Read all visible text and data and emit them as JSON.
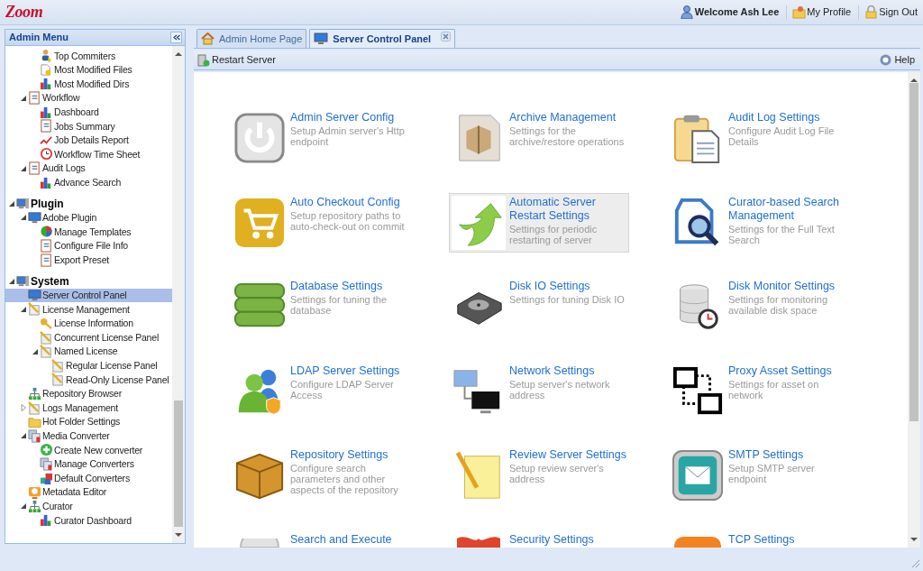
{
  "header": {
    "logo": "Zoom",
    "welcome": "Welcome Ash Lee",
    "links": [
      "My Profile",
      "Sign Out"
    ]
  },
  "sidebar": {
    "title": "Admin Menu",
    "tree": [
      {
        "children": [
          {
            "children": [
              {
                "label": "Top Commiters",
                "selected": false
              },
              {
                "label": "Most Modified Files",
                "selected": false
              },
              {
                "label": "Most Modified Dirs",
                "selected": false
              }
            ]
          },
          {
            "label": "Workflow",
            "selected": false,
            "expanded": true,
            "children": [
              {
                "label": "Dashboard",
                "selected": false
              },
              {
                "label": "Jobs Summary",
                "selected": false
              },
              {
                "label": "Job Details Report",
                "selected": false
              },
              {
                "label": "Workflow Time Sheet",
                "selected": false
              }
            ]
          },
          {
            "label": "Audit Logs",
            "selected": false,
            "expanded": true,
            "children": [
              {
                "label": "Advance Search",
                "selected": false
              }
            ]
          }
        ]
      },
      {
        "label": "Plugin",
        "selected": false,
        "expanded": true,
        "children": [
          {
            "label": "Adobe Plugin",
            "selected": false,
            "expanded": true,
            "children": [
              {
                "label": "Manage Templates",
                "selected": false
              },
              {
                "label": "Configure File Info",
                "selected": false
              },
              {
                "label": "Export Preset",
                "selected": false
              }
            ]
          }
        ]
      },
      {
        "label": "System",
        "selected": false,
        "expanded": true,
        "children": [
          {
            "label": "Server Control Panel",
            "selected": true
          },
          {
            "label": "License Management",
            "selected": false,
            "expanded": true,
            "children": [
              {
                "label": "License Information",
                "selected": false
              },
              {
                "label": "Concurrent License Panel",
                "selected": false
              },
              {
                "label": "Named License",
                "selected": false,
                "expanded": true,
                "children": [
                  {
                    "label": "Regular License Panel",
                    "selected": false
                  },
                  {
                    "label": "Read-Only License Panel",
                    "selected": false
                  }
                ]
              }
            ]
          },
          {
            "label": "Repository Browser",
            "selected": false
          },
          {
            "label": "Logs Management",
            "selected": false,
            "expanded": false
          },
          {
            "label": "Hot Folder Settings",
            "selected": false
          },
          {
            "label": "Media Converter",
            "selected": false,
            "expanded": true,
            "children": [
              {
                "label": "Create New converter",
                "selected": false
              },
              {
                "label": "Manage Converters",
                "selected": false
              },
              {
                "label": "Default Converters",
                "selected": false
              }
            ]
          },
          {
            "label": "Metadata Editor",
            "selected": false
          },
          {
            "label": "Curator",
            "selected": false,
            "expanded": true,
            "children": [
              {
                "label": "Curator Dashboard",
                "selected": false
              }
            ]
          }
        ]
      }
    ]
  },
  "tabs": [
    {
      "label": "Admin Home Page",
      "selected": false,
      "closable": false
    },
    {
      "label": "Server Control Panel",
      "selected": true,
      "closable": true
    }
  ],
  "toolbar": {
    "restart": "Restart Server",
    "help": "Help"
  },
  "cards": [
    {
      "title": "Admin Server Config",
      "description": "Setup Admin server's Http endpoint",
      "selected": false
    },
    {
      "title": "Archive Management",
      "description": "Settings for the archive/restore operations",
      "selected": false
    },
    {
      "title": "Audit Log Settings",
      "description": "Configure Audit Log File Details",
      "selected": false
    },
    {
      "title": "Auto Checkout Config",
      "description": "Setup repository paths to auto-check-out on commit",
      "selected": false
    },
    {
      "title": "Automatic Server Restart Settings",
      "description": "Settings for periodic restarting of server",
      "selected": true
    },
    {
      "title": "Curator-based Search Management",
      "description": "Settings for the Full Text Search",
      "selected": false
    },
    {
      "title": "Database Settings",
      "description": "Settings for tuning the database",
      "selected": false
    },
    {
      "title": "Disk IO Settings",
      "description": "Settings for tuning Disk IO",
      "selected": false
    },
    {
      "title": "Disk Monitor Settings",
      "description": "Settings for monitoring available disk space",
      "selected": false
    },
    {
      "title": "LDAP Server Settings",
      "description": "Configure LDAP Server Access",
      "selected": false
    },
    {
      "title": "Network Settings",
      "description": "Setup server's network address",
      "selected": false
    },
    {
      "title": "Proxy Asset Settings",
      "description": "Settings for asset on network",
      "selected": false
    },
    {
      "title": "Repository Settings",
      "description": "Configure search parameters and other aspects of the repository",
      "selected": false
    },
    {
      "title": "Review Server Settings",
      "description": "Setup review server's address",
      "selected": false
    },
    {
      "title": "SMTP Settings",
      "description": "Setup SMTP server endpoint",
      "selected": false
    },
    {
      "title": "Search and Execute",
      "selected": false
    },
    {
      "title": "Security Settings",
      "selected": false
    },
    {
      "title": "TCP Settings",
      "selected": false
    }
  ]
}
